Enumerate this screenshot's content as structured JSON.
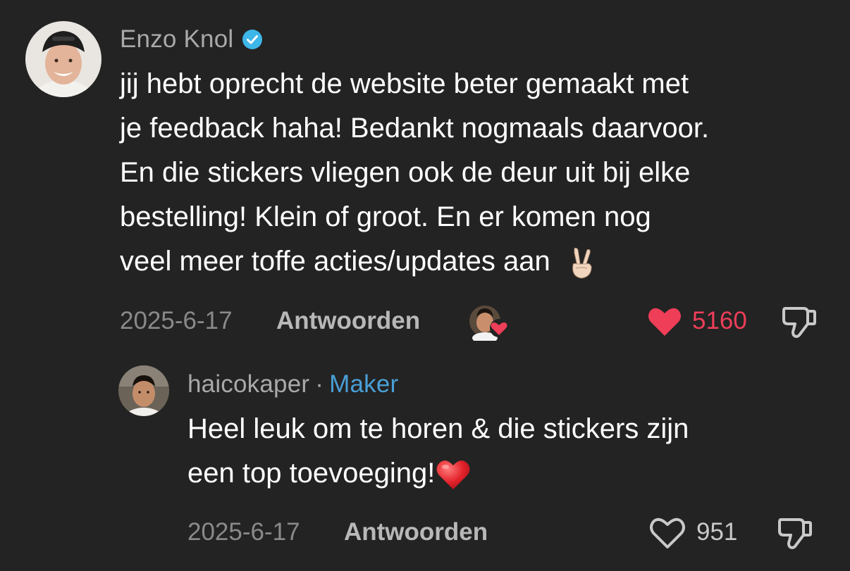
{
  "comment": {
    "author": "Enzo Knol",
    "verified": true,
    "lines": [
      "jij hebt oprecht de website beter gemaakt met",
      "je feedback haha! Bedankt nogmaals daarvoor.",
      "En die stickers vliegen ook de deur uit bij elke",
      "bestelling! Klein of groot. En er komen nog",
      "veel meer toffe acties/updates aan"
    ],
    "emoji": "peace-hand-emoji",
    "date": "2025-6-17",
    "reply_label": "Antwoorden",
    "creator_liked": true,
    "likes": "5160",
    "liked": true,
    "like_color": "#ee3e58"
  },
  "reply": {
    "author": "haicokaper",
    "separator": "·",
    "badge": "Maker",
    "badge_color": "#4a9fd6",
    "lines": [
      "Heel leuk om te horen & die stickers zijn",
      "een top toevoeging!"
    ],
    "emoji": "red-heart-emoji",
    "date": "2025-6-17",
    "reply_label": "Antwoorden",
    "likes": "951",
    "liked": false
  }
}
